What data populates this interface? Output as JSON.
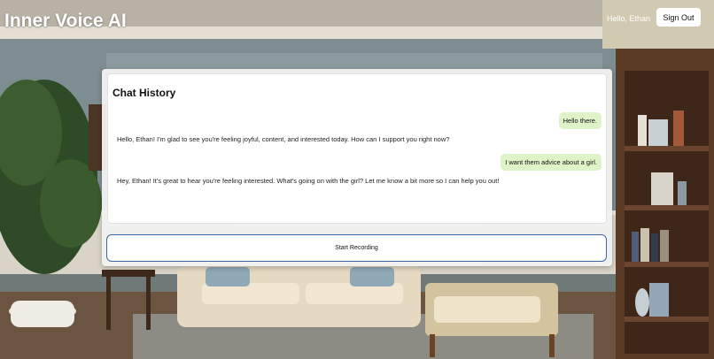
{
  "header": {
    "app_title": "Inner Voice AI",
    "greeting": "Hello, Ethan",
    "signout_label": "Sign Out"
  },
  "chat": {
    "title": "Chat History",
    "messages": [
      {
        "role": "user",
        "text": "Hello there."
      },
      {
        "role": "assistant",
        "text": "Hello, Ethan! I'm glad to see you're feeling joyful, content, and interested today. How can I support you right now?"
      },
      {
        "role": "user",
        "text": "I want them advice about a girl."
      },
      {
        "role": "assistant",
        "text": "Hey, Ethan! It's great to hear you're feeling interested. What's going on with the girl? Let me know a bit more so I can help you out!"
      }
    ]
  },
  "controls": {
    "record_label": "Start Recording"
  },
  "colors": {
    "user_bubble": "#dff3c9",
    "record_border": "#3a64a8"
  }
}
